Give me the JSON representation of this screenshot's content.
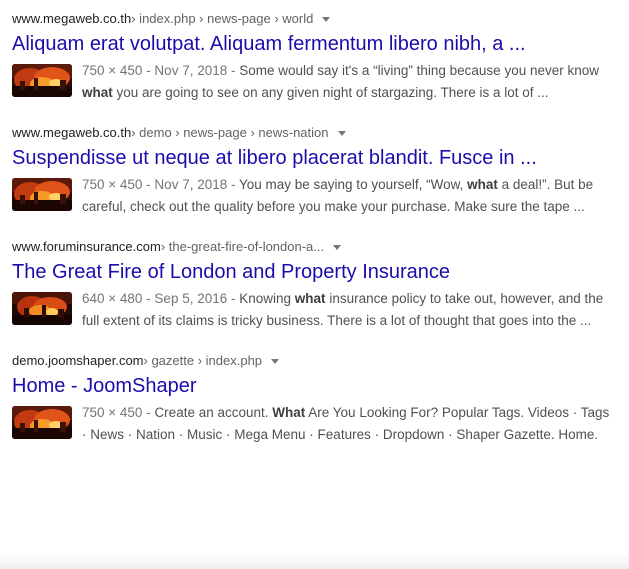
{
  "colors": {
    "link": "#1a0dab",
    "text": "#202124",
    "snippet": "#4d5156",
    "meta": "#70757a"
  },
  "results": [
    {
      "domain": "www.megaweb.co.th",
      "path": " › index.php › news-page › world",
      "title": "Aliquam erat volutpat. Aliquam fermentum libero nibh, a ...",
      "meta": "750 × 450 - Nov 7, 2018 - ",
      "snippet_before": "Some would say it's a “living” thing because you never know ",
      "snippet_bold": "what",
      "snippet_after": " you are going to see on any given night of stargazing. There is a lot of ..."
    },
    {
      "domain": "www.megaweb.co.th",
      "path": " › demo › news-page › news-nation",
      "title": "Suspendisse ut neque at libero placerat blandit. Fusce in ...",
      "meta": "750 × 450 - Nov 7, 2018 - ",
      "snippet_before": "You may be saying to yourself, “Wow, ",
      "snippet_bold": "what",
      "snippet_after": " a deal!”. But be careful, check out the quality before you make your purchase. Make sure the tape ..."
    },
    {
      "domain": "www.foruminsurance.com",
      "path": " › the-great-fire-of-london-a...",
      "title": "The Great Fire of London and Property Insurance",
      "meta": "640 × 480 - Sep 5, 2016 - ",
      "snippet_before": "Knowing ",
      "snippet_bold": "what",
      "snippet_after": " insurance policy to take out, however, and the full extent of its claims is tricky business. There is a lot of thought that goes into the ..."
    },
    {
      "domain": "demo.joomshaper.com",
      "path": " › gazette › index.php",
      "title": "Home - JoomShaper",
      "meta": "750 × 450 - ",
      "snippet_before": "Create an account. ",
      "snippet_bold": "What",
      "snippet_after": " Are You Looking For? Popular Tags. Videos · Tags · News · Nation · Music · Mega Menu · Features · Dropdown · Shaper Gazette. Home."
    }
  ]
}
